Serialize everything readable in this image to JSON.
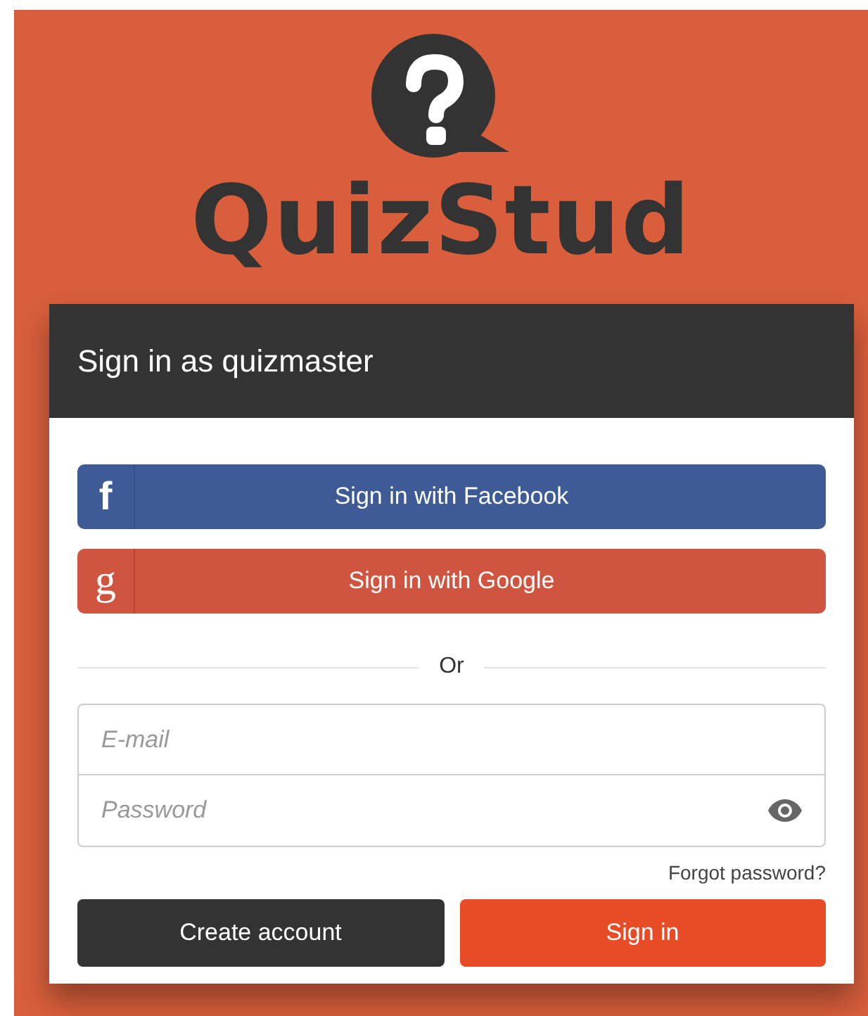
{
  "logo": {
    "text": "QuizStud"
  },
  "panel": {
    "title": "Sign in as quizmaster"
  },
  "social_buttons": [
    {
      "kind": "facebook",
      "icon": "f",
      "label": "Sign in with Facebook"
    },
    {
      "kind": "google",
      "icon": "g",
      "label": "Sign in with Google"
    }
  ],
  "divider": {
    "label": "Or"
  },
  "fields": [
    {
      "kind": "email",
      "placeholder": "E-mail"
    },
    {
      "kind": "password",
      "placeholder": "Password"
    }
  ],
  "forgot_link": "Forgot password?",
  "buttons": [
    {
      "kind": "secondary",
      "label": "Create account"
    },
    {
      "kind": "primary",
      "label": "Sign in"
    }
  ]
}
